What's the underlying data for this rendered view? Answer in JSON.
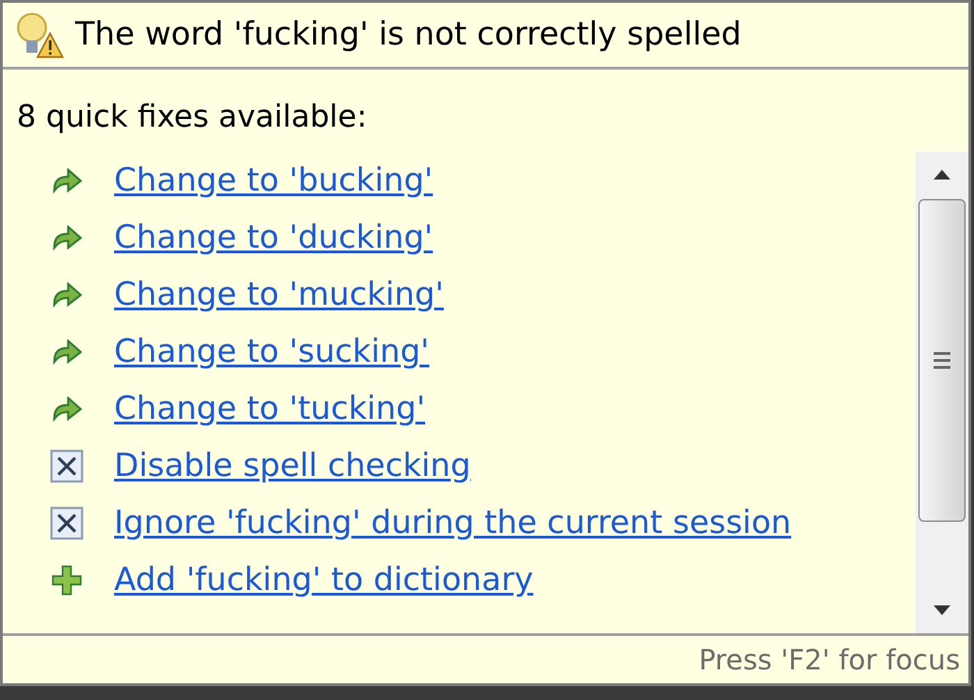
{
  "header": {
    "title": "The word 'fucking' is not correctly spelled"
  },
  "summary": "8 quick fixes available:",
  "fixes": [
    {
      "kind": "change",
      "label": "Change to 'bucking'"
    },
    {
      "kind": "change",
      "label": "Change to 'ducking'"
    },
    {
      "kind": "change",
      "label": "Change to 'mucking'"
    },
    {
      "kind": "change",
      "label": "Change to 'sucking'"
    },
    {
      "kind": "change",
      "label": "Change to 'tucking'"
    },
    {
      "kind": "disable",
      "label": "Disable spell checking"
    },
    {
      "kind": "disable",
      "label": "Ignore 'fucking' during the current session"
    },
    {
      "kind": "add",
      "label": "Add 'fucking' to dictionary"
    }
  ],
  "status_bar": "Press 'F2' for focus"
}
